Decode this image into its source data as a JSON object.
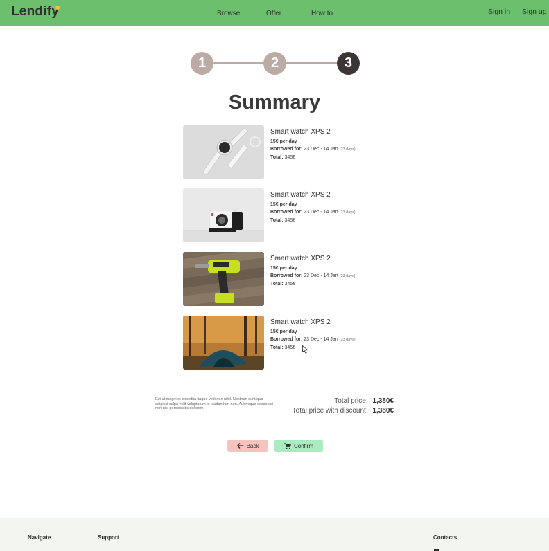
{
  "header": {
    "logo": "Lendify",
    "nav": [
      "Browse",
      "Offer",
      "How to"
    ],
    "sign_in": "Sign in",
    "sign_up": "Sign up"
  },
  "stepper": {
    "steps": [
      "1",
      "2",
      "3"
    ],
    "current": 3
  },
  "page_title": "Summary",
  "items": [
    {
      "name": "Smart watch XPS 2",
      "price_per_day": "15€ per day",
      "borrowed_label": "Borrowed for:",
      "borrowed_range": "23 Dec - 14 Jan",
      "days": "(23 days)",
      "total_label": "Total:",
      "total_value": "345€",
      "image_icon": "smart-watch-image"
    },
    {
      "name": "Smart watch XPS 2",
      "price_per_day": "15€ per day",
      "borrowed_label": "Borrowed for:",
      "borrowed_range": "23 Dec - 14 Jan",
      "days": "(23 days)",
      "total_label": "Total:",
      "total_value": "345€",
      "image_icon": "instant-camera-image"
    },
    {
      "name": "Smart watch XPS 2",
      "price_per_day": "15€ per day",
      "borrowed_label": "Borrowed for:",
      "borrowed_range": "23 Dec - 14 Jan",
      "days": "(23 days)",
      "total_label": "Total:",
      "total_value": "345€",
      "image_icon": "power-drill-image"
    },
    {
      "name": "Smart watch XPS 2",
      "price_per_day": "15€ per day",
      "borrowed_label": "Borrowed for:",
      "borrowed_range": "23 Dec - 14 Jan",
      "days": "(23 days)",
      "total_label": "Total:",
      "total_value": "345€",
      "image_icon": "tent-image"
    }
  ],
  "summary": {
    "note": "Est ut magni et expedita itaque velit non nihil. Nostrum sunt qua adipisci culpa velit voluptatum in laudantium non. Aut neque occaecati non nisi perspiciatis dolorem.",
    "total_price_label": "Total price:",
    "total_price_value": "1,380€",
    "discount_price_label": "Total price with discount:",
    "discount_price_value": "1,380€"
  },
  "buttons": {
    "back": "Back",
    "confirm": "Confirm",
    "back_icon": "arrow-left-icon",
    "confirm_icon": "cart-icon"
  },
  "footer": {
    "columns": [
      "Navigate",
      "Support",
      "Contacts"
    ]
  },
  "colors": {
    "header_bg": "#6cbf6d",
    "step_inactive": "#bcaaa4",
    "step_active": "#3b3533",
    "back_bg": "#f8c3bd",
    "confirm_bg": "#a8ecc0",
    "logo_dot": "#f2c12e"
  }
}
